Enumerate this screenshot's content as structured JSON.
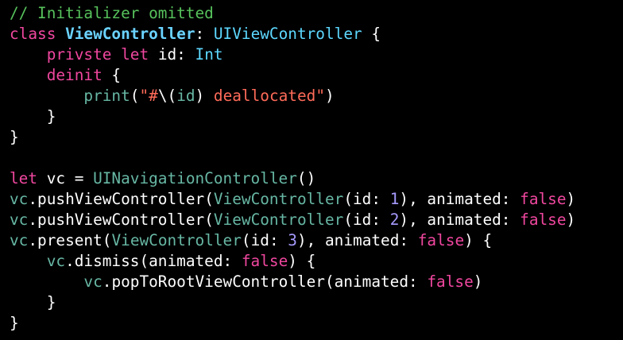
{
  "editor": {
    "colors": {
      "background": "#000000",
      "comment": "#57c25c",
      "keyword": "#f0479f",
      "type": "#5dd8ff",
      "class": "#67b7a4",
      "number": "#a69bff",
      "string": "#ff6b59",
      "plain": "#ffffff"
    },
    "lines": [
      [
        {
          "k": "comment",
          "t": "// Initializer omitted"
        }
      ],
      [
        {
          "k": "keyword",
          "t": "class"
        },
        {
          "k": "plain",
          "t": " "
        },
        {
          "k": "type-decl",
          "t": "ViewController"
        },
        {
          "k": "plain",
          "t": ": "
        },
        {
          "k": "type",
          "t": "UIViewController"
        },
        {
          "k": "plain",
          "t": " {"
        }
      ],
      [
        {
          "k": "plain",
          "t": "    "
        },
        {
          "k": "keyword",
          "t": "privste"
        },
        {
          "k": "plain",
          "t": " "
        },
        {
          "k": "keyword",
          "t": "let"
        },
        {
          "k": "plain",
          "t": " id: "
        },
        {
          "k": "type",
          "t": "Int"
        }
      ],
      [
        {
          "k": "plain",
          "t": "    "
        },
        {
          "k": "keyword",
          "t": "deinit"
        },
        {
          "k": "plain",
          "t": " {"
        }
      ],
      [
        {
          "k": "plain",
          "t": "        "
        },
        {
          "k": "func",
          "t": "print"
        },
        {
          "k": "plain",
          "t": "("
        },
        {
          "k": "string",
          "t": "\"#"
        },
        {
          "k": "plain",
          "t": "\\("
        },
        {
          "k": "class",
          "t": "id"
        },
        {
          "k": "plain",
          "t": ") "
        },
        {
          "k": "string",
          "t": "deallocated\""
        },
        {
          "k": "plain",
          "t": ")"
        }
      ],
      [
        {
          "k": "plain",
          "t": "    }"
        }
      ],
      [
        {
          "k": "plain",
          "t": "}"
        }
      ],
      [
        {
          "k": "plain",
          "t": ""
        }
      ],
      [
        {
          "k": "keyword",
          "t": "let"
        },
        {
          "k": "plain",
          "t": " vc = "
        },
        {
          "k": "class",
          "t": "UINavigationController"
        },
        {
          "k": "plain",
          "t": "()"
        }
      ],
      [
        {
          "k": "member",
          "t": "vc"
        },
        {
          "k": "plain",
          "t": "."
        },
        {
          "k": "plain",
          "t": "pushViewController"
        },
        {
          "k": "plain",
          "t": "("
        },
        {
          "k": "class",
          "t": "ViewController"
        },
        {
          "k": "plain",
          "t": "(id: "
        },
        {
          "k": "number",
          "t": "1"
        },
        {
          "k": "plain",
          "t": "), animated: "
        },
        {
          "k": "keyword",
          "t": "false"
        },
        {
          "k": "plain",
          "t": ")"
        }
      ],
      [
        {
          "k": "member",
          "t": "vc"
        },
        {
          "k": "plain",
          "t": "."
        },
        {
          "k": "plain",
          "t": "pushViewController"
        },
        {
          "k": "plain",
          "t": "("
        },
        {
          "k": "class",
          "t": "ViewController"
        },
        {
          "k": "plain",
          "t": "(id: "
        },
        {
          "k": "number",
          "t": "2"
        },
        {
          "k": "plain",
          "t": "), animated: "
        },
        {
          "k": "keyword",
          "t": "false"
        },
        {
          "k": "plain",
          "t": ")"
        }
      ],
      [
        {
          "k": "member",
          "t": "vc"
        },
        {
          "k": "plain",
          "t": "."
        },
        {
          "k": "plain",
          "t": "present"
        },
        {
          "k": "plain",
          "t": "("
        },
        {
          "k": "class",
          "t": "ViewController"
        },
        {
          "k": "plain",
          "t": "(id: "
        },
        {
          "k": "number",
          "t": "3"
        },
        {
          "k": "plain",
          "t": "), animated: "
        },
        {
          "k": "keyword",
          "t": "false"
        },
        {
          "k": "plain",
          "t": ") {"
        }
      ],
      [
        {
          "k": "plain",
          "t": "    "
        },
        {
          "k": "member",
          "t": "vc"
        },
        {
          "k": "plain",
          "t": ".dismiss(animated: "
        },
        {
          "k": "keyword",
          "t": "false"
        },
        {
          "k": "plain",
          "t": ") {"
        }
      ],
      [
        {
          "k": "plain",
          "t": "        "
        },
        {
          "k": "member",
          "t": "vc"
        },
        {
          "k": "plain",
          "t": ".popToRootViewController(animated: "
        },
        {
          "k": "keyword",
          "t": "false"
        },
        {
          "k": "plain",
          "t": ")"
        }
      ],
      [
        {
          "k": "plain",
          "t": "    }"
        }
      ],
      [
        {
          "k": "plain",
          "t": "}"
        }
      ]
    ]
  }
}
